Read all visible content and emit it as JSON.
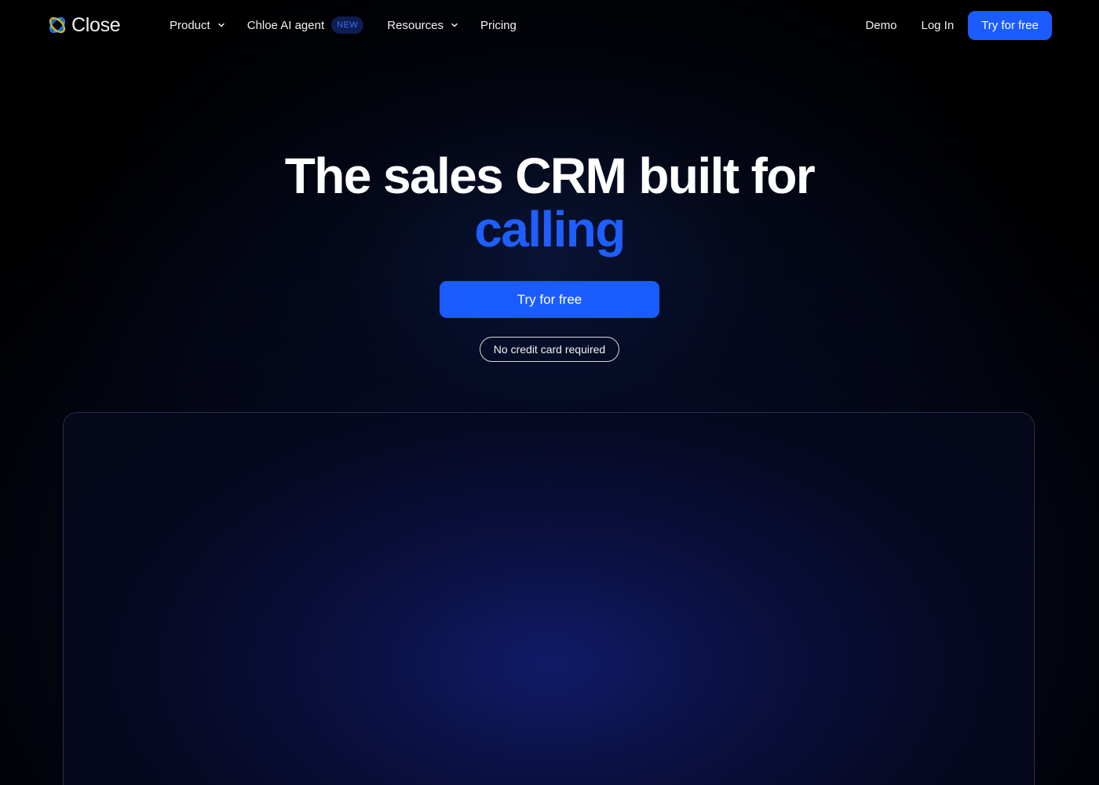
{
  "brand": {
    "name": "Close",
    "logo_icon": "close-logo-rings-icon"
  },
  "nav": {
    "items": [
      {
        "label": "Product",
        "has_dropdown": true
      },
      {
        "label": "Chloe AI agent",
        "badge": "NEW"
      },
      {
        "label": "Resources",
        "has_dropdown": true
      },
      {
        "label": "Pricing"
      }
    ],
    "demo_label": "Demo",
    "login_label": "Log In",
    "cta_label": "Try for free"
  },
  "hero": {
    "title_line1": "The sales CRM built for",
    "title_line2": "calling",
    "cta_label": "Try for free",
    "note": "No credit card required"
  },
  "colors": {
    "accent": "#1a5cff",
    "background": "#000000",
    "text": "#ffffff",
    "badge_bg": "#0e1d52",
    "badge_text": "#3f6dff"
  }
}
